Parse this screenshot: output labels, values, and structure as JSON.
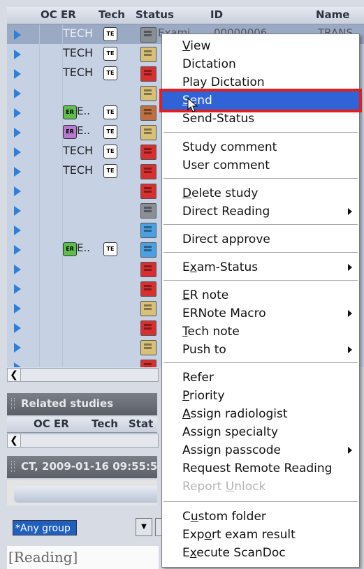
{
  "columns": {
    "oc": "OC",
    "er": "ER",
    "tech": "Tech",
    "status": "Status",
    "id": "ID",
    "name": "Name"
  },
  "row_tech_label": "TECH",
  "badge_er": "ER",
  "badge_te": "TE",
  "er_ellipsis": "E..",
  "first_row": {
    "status_text": "Exami...",
    "id_text": "00000006",
    "name_text": "TRANS"
  },
  "rows": [
    {
      "tech": "TECH",
      "er": "",
      "te": true,
      "status_color": "#8a8f96"
    },
    {
      "tech": "TECH",
      "er": "",
      "te": true,
      "status_color": "#d8c078"
    },
    {
      "tech": "TECH",
      "er": "",
      "te": true,
      "status_color": "#d83030"
    },
    {
      "tech": "",
      "er": "",
      "te": false,
      "status_color": "#d8c078"
    },
    {
      "tech": "",
      "er": "green",
      "te": true,
      "status_color": "#c07040"
    },
    {
      "tech": "",
      "er": "purple",
      "te": true,
      "status_color": "#d8c078"
    },
    {
      "tech": "TECH",
      "er": "",
      "te": true,
      "status_color": "#d83030"
    },
    {
      "tech": "TECH",
      "er": "",
      "te": true,
      "status_color": "#d83030"
    },
    {
      "tech": "",
      "er": "",
      "te": false,
      "status_color": "#d83030"
    },
    {
      "tech": "",
      "er": "",
      "te": false,
      "status_color": "#8a8f96"
    },
    {
      "tech": "",
      "er": "",
      "te": false,
      "status_color": "#4aa0e0"
    },
    {
      "tech": "",
      "er": "green",
      "te": true,
      "status_color": "#4aa0e0"
    },
    {
      "tech": "",
      "er": "",
      "te": false,
      "status_color": "#d83030"
    },
    {
      "tech": "",
      "er": "",
      "te": false,
      "status_color": "#d83030"
    },
    {
      "tech": "",
      "er": "",
      "te": false,
      "status_color": "#d8c078"
    },
    {
      "tech": "",
      "er": "",
      "te": false,
      "status_color": "#d83030"
    },
    {
      "tech": "",
      "er": "",
      "te": false,
      "status_color": "#d8c078"
    },
    {
      "tech": "",
      "er": "",
      "te": false,
      "status_color": "#d83030"
    }
  ],
  "panels": {
    "related_studies": "Related studies",
    "study_info": "CT, 2009-01-16 09:55:5"
  },
  "related_columns": {
    "oc": "OC",
    "er": "ER",
    "tech": "Tech",
    "status": "Stat"
  },
  "group_select": {
    "value": "*Any group"
  },
  "status_field": "[Reading]",
  "colors": {
    "highlight": "#3063d6",
    "highlight_border": "#e0201e",
    "accent_arrow": "#2f7fd6"
  },
  "menu": {
    "items": [
      {
        "label": "View",
        "underline": 0,
        "submenu": false,
        "disabled": false
      },
      {
        "label": "Dictation",
        "underline": -1,
        "submenu": false,
        "disabled": false
      },
      {
        "label": "Play Dictation",
        "underline": -1,
        "submenu": false,
        "disabled": false
      },
      {
        "label": "Send",
        "underline": 0,
        "submenu": false,
        "disabled": false,
        "highlighted": true
      },
      {
        "label": "Send-Status",
        "underline": -1,
        "submenu": false,
        "disabled": false
      },
      {
        "label": "Study comment",
        "underline": -1,
        "submenu": false,
        "disabled": false
      },
      {
        "label": "User comment",
        "underline": -1,
        "submenu": false,
        "disabled": false
      },
      {
        "label": "Delete study",
        "underline": 0,
        "submenu": false,
        "disabled": false
      },
      {
        "label": "Direct Reading",
        "underline": -1,
        "submenu": true,
        "disabled": false
      },
      {
        "label": "Direct approve",
        "underline": -1,
        "submenu": false,
        "disabled": false
      },
      {
        "label": "Exam-Status",
        "underline": 1,
        "submenu": true,
        "disabled": false
      },
      {
        "label": "ER note",
        "underline": 0,
        "submenu": false,
        "disabled": false
      },
      {
        "label": "ERNote Macro",
        "underline": -1,
        "submenu": true,
        "disabled": false
      },
      {
        "label": "Tech note",
        "underline": 0,
        "submenu": false,
        "disabled": false
      },
      {
        "label": "Push to",
        "underline": -1,
        "submenu": true,
        "disabled": false
      },
      {
        "label": "Refer",
        "underline": -1,
        "submenu": false,
        "disabled": false
      },
      {
        "label": "Priority",
        "underline": 0,
        "submenu": false,
        "disabled": false
      },
      {
        "label": "Assign radiologist",
        "underline": 0,
        "submenu": false,
        "disabled": false
      },
      {
        "label": "Assign specialty",
        "underline": -1,
        "submenu": false,
        "disabled": false
      },
      {
        "label": "Assign passcode",
        "underline": -1,
        "submenu": true,
        "disabled": false
      },
      {
        "label": "Request Remote Reading",
        "underline": -1,
        "submenu": false,
        "disabled": false
      },
      {
        "label": "Report Unlock",
        "underline": 7,
        "submenu": false,
        "disabled": true
      },
      {
        "label": "Custom folder",
        "underline": 1,
        "submenu": false,
        "disabled": false
      },
      {
        "label": "Export exam result",
        "underline": 3,
        "submenu": false,
        "disabled": false
      },
      {
        "label": "Execute ScanDoc",
        "underline": 1,
        "submenu": false,
        "disabled": false
      }
    ]
  }
}
